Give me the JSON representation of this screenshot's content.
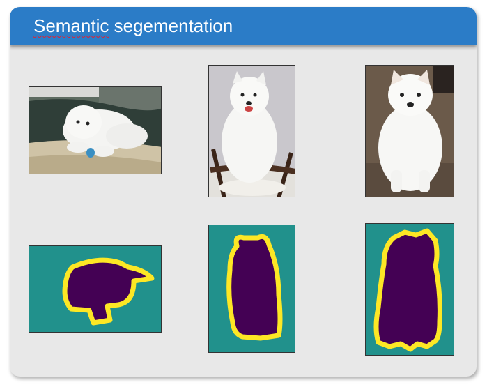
{
  "slide": {
    "title_part1": "Semantic",
    "title_part2": " segementation"
  },
  "colors": {
    "header": "#2b7cc7",
    "mask_background": "#21918c",
    "mask_boundary": "#fde725",
    "mask_object": "#440154"
  },
  "photos": [
    {
      "subject": "white dog lying on a blanket"
    },
    {
      "subject": "white dog sitting on a chair"
    },
    {
      "subject": "white dog sitting on a carpet"
    }
  ],
  "masks": [
    {
      "classes": [
        "background",
        "boundary",
        "dog"
      ]
    },
    {
      "classes": [
        "background",
        "boundary",
        "dog"
      ]
    },
    {
      "classes": [
        "background",
        "boundary",
        "dog"
      ]
    }
  ]
}
